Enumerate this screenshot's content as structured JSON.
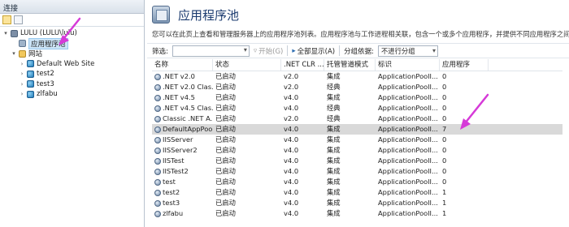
{
  "connections": {
    "header": "连接",
    "tree": [
      {
        "label": "LULU (LULU\\lulu)",
        "level": 0,
        "expander": "▾",
        "icon": "server-icon"
      },
      {
        "label": "应用程序池",
        "level": 1,
        "expander": "",
        "icon": "app-pool-icon",
        "selected": true
      },
      {
        "label": "网站",
        "level": 1,
        "expander": "▾",
        "icon": "folder-icon"
      },
      {
        "label": "Default Web Site",
        "level": 2,
        "expander": "›",
        "icon": "globe-icon"
      },
      {
        "label": "test2",
        "level": 2,
        "expander": "›",
        "icon": "globe-icon"
      },
      {
        "label": "test3",
        "level": 2,
        "expander": "›",
        "icon": "globe-icon"
      },
      {
        "label": "zlfabu",
        "level": 2,
        "expander": "›",
        "icon": "globe-icon"
      }
    ]
  },
  "main": {
    "title": "应用程序池",
    "description": "您可以在此页上查看和管理服务器上的应用程序池列表。应用程序池与工作进程相关联，包含一个或多个应用程序，并提供不同应用程序之间的隔离。",
    "filter": {
      "label": "筛选:",
      "start_label": "开始(G)",
      "show_all_label": "全部显示(A)",
      "group_label": "分组依据:",
      "group_value": "不进行分组"
    },
    "columns": [
      "名称",
      "状态",
      ".NET CLR ...",
      "托管管道模式",
      "标识",
      "应用程序"
    ],
    "rows": [
      {
        "name": ".NET v2.0",
        "status": "已启动",
        "clr": "v2.0",
        "pipeline": "集成",
        "identity": "ApplicationPoolI...",
        "apps": "0"
      },
      {
        "name": ".NET v2.0 Clas...",
        "status": "已启动",
        "clr": "v2.0",
        "pipeline": "经典",
        "identity": "ApplicationPoolI...",
        "apps": "0"
      },
      {
        "name": ".NET v4.5",
        "status": "已启动",
        "clr": "v4.0",
        "pipeline": "集成",
        "identity": "ApplicationPoolI...",
        "apps": "0"
      },
      {
        "name": ".NET v4.5 Clas...",
        "status": "已启动",
        "clr": "v4.0",
        "pipeline": "经典",
        "identity": "ApplicationPoolI...",
        "apps": "0"
      },
      {
        "name": "Classic .NET A...",
        "status": "已启动",
        "clr": "v2.0",
        "pipeline": "经典",
        "identity": "ApplicationPoolI...",
        "apps": "0"
      },
      {
        "name": "DefaultAppPool",
        "status": "已启动",
        "clr": "v4.0",
        "pipeline": "集成",
        "identity": "ApplicationPoolI...",
        "apps": "7",
        "selected": true
      },
      {
        "name": "IISServer",
        "status": "已启动",
        "clr": "v4.0",
        "pipeline": "集成",
        "identity": "ApplicationPoolI...",
        "apps": "0"
      },
      {
        "name": "IISServer2",
        "status": "已启动",
        "clr": "v4.0",
        "pipeline": "集成",
        "identity": "ApplicationPoolI...",
        "apps": "0"
      },
      {
        "name": "IISTest",
        "status": "已启动",
        "clr": "v4.0",
        "pipeline": "集成",
        "identity": "ApplicationPoolI...",
        "apps": "0"
      },
      {
        "name": "IISTest2",
        "status": "已启动",
        "clr": "v4.0",
        "pipeline": "集成",
        "identity": "ApplicationPoolI...",
        "apps": "0"
      },
      {
        "name": "test",
        "status": "已启动",
        "clr": "v4.0",
        "pipeline": "集成",
        "identity": "ApplicationPoolI...",
        "apps": "0"
      },
      {
        "name": "test2",
        "status": "已启动",
        "clr": "v4.0",
        "pipeline": "集成",
        "identity": "ApplicationPoolI...",
        "apps": "1"
      },
      {
        "name": "test3",
        "status": "已启动",
        "clr": "v4.0",
        "pipeline": "集成",
        "identity": "ApplicationPoolI...",
        "apps": "1"
      },
      {
        "name": "zlfabu",
        "status": "已启动",
        "clr": "v4.0",
        "pipeline": "集成",
        "identity": "ApplicationPoolI...",
        "apps": "1"
      }
    ]
  },
  "colors": {
    "annotation_arrow": "#d63ad8",
    "selection": "#cce4f7",
    "row_selected": "#d9d9d9",
    "title": "#1b3b6f"
  }
}
